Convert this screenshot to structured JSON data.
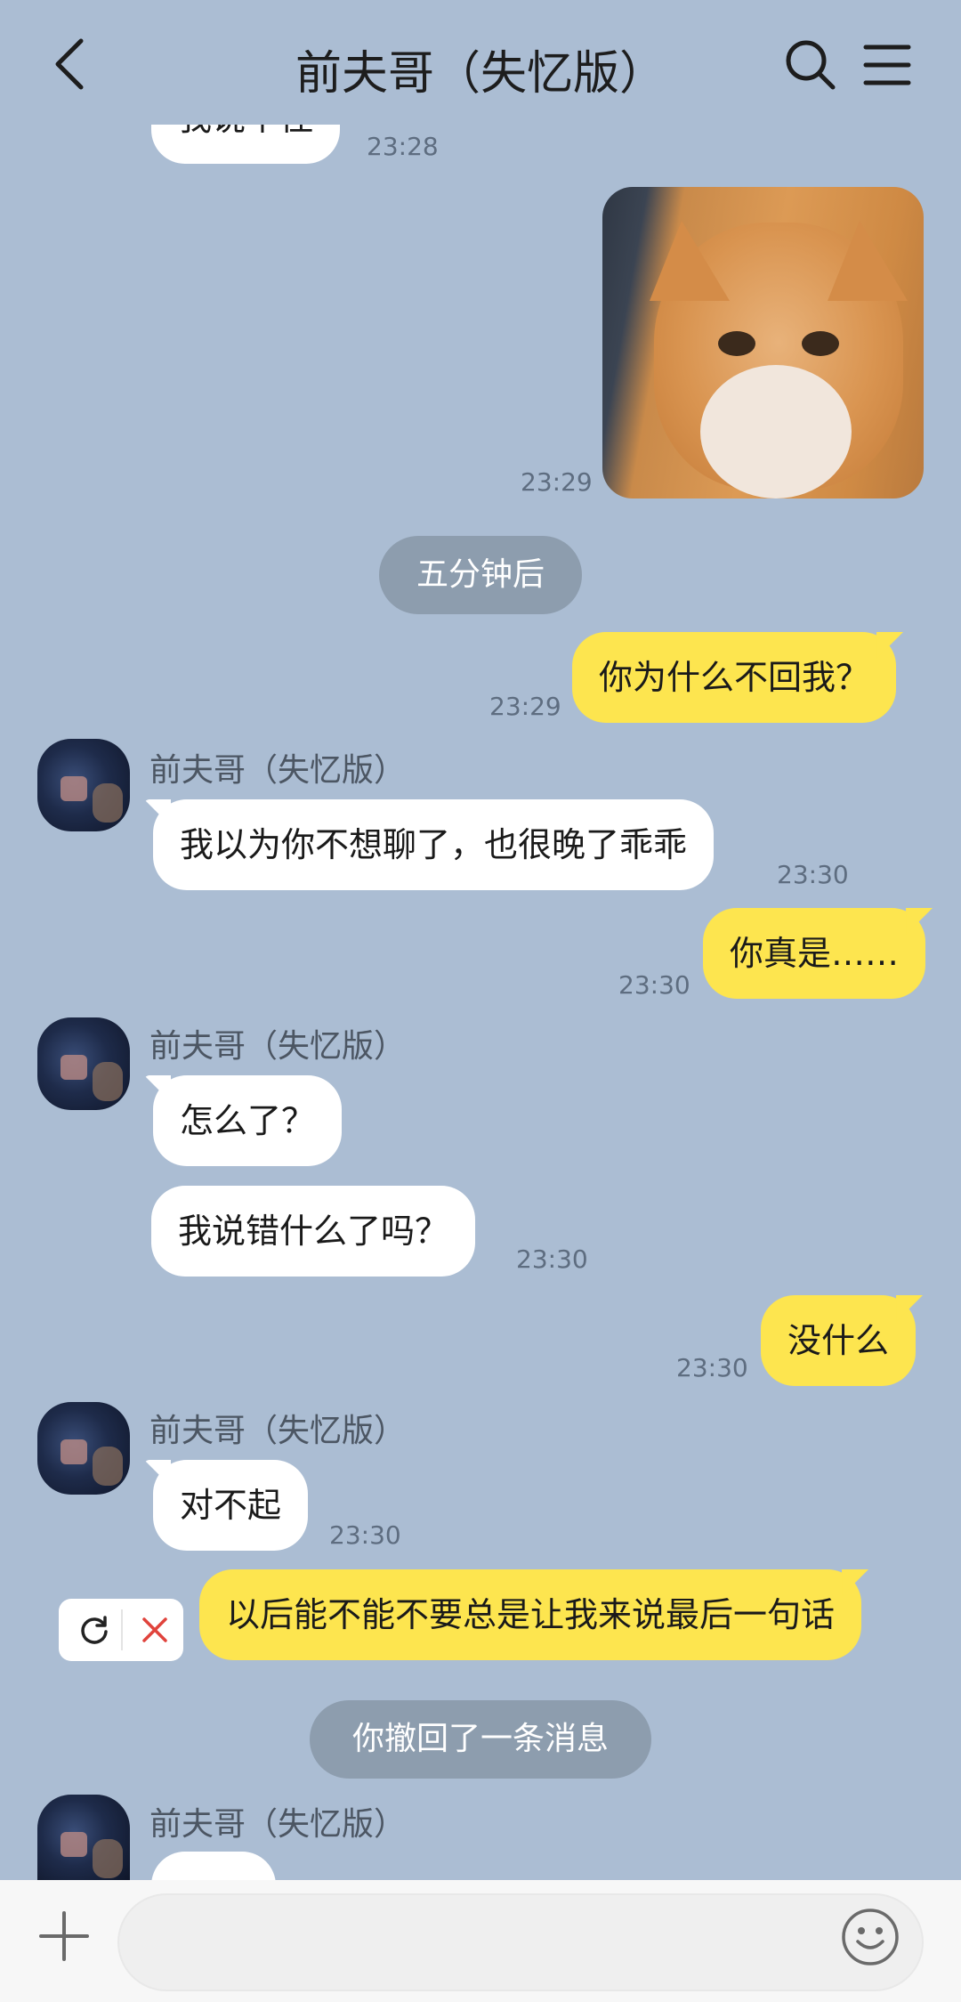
{
  "header": {
    "title": "前夫哥（失忆版）"
  },
  "contact": {
    "name": "前夫哥（失忆版）"
  },
  "messages": {
    "m0_partial": "我说个住",
    "t0": "23:28",
    "t_img": "23:29",
    "sys1": "五分钟后",
    "m1": "你为什么不回我？",
    "t1": "23:29",
    "m2": "我以为你不想聊了，也很晚了乖乖",
    "t2": "23:30",
    "m3": "你真是……",
    "t3": "23:30",
    "m4": "怎么了？",
    "m5": "我说错什么了吗？",
    "t5": "23:30",
    "m6": "没什么",
    "t6": "23:30",
    "m7": "对不起",
    "t7": "23:30",
    "m8": "以后能不能不要总是让我来说最后一句话",
    "sys2": "你撤回了一条消息"
  },
  "input": {
    "placeholder": ""
  },
  "colors": {
    "background": "#abbdd3",
    "outgoing": "#fde54f",
    "incoming": "#ffffff",
    "system": "#8d9dae"
  }
}
